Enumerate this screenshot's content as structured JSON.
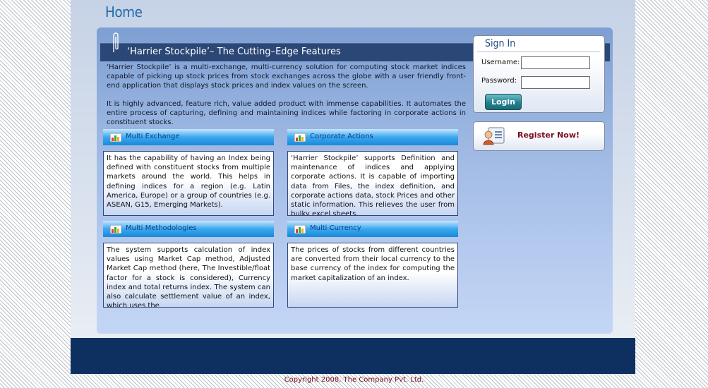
{
  "header": {
    "title": "Home"
  },
  "feature": {
    "title": "‘Harrier Stockpile’– The Cutting–Edge Features",
    "intro": [
      "‘Harrier Stockpile’ is a multi-exchange, multi-currency solution for computing stock market indices capable of picking up stock prices from stock exchanges across the globe with a user friendly front-end application that displays stock prices and index values on the screen.",
      "It is highly advanced, feature rich, value added product with immense capabilities. It automates the entire process of capturing, defining and maintaining indices while factoring in corporate actions in constituent stocks."
    ]
  },
  "boxes": [
    {
      "label": "Multi Exchange",
      "text": "It has the capability of having an Index being defined with constituent stocks from multiple markets around the world. This helps in defining indices for a region (e.g. Latin America, Europe) or a group of countries (e.g. ASEAN, G15, Emerging Markets)."
    },
    {
      "label": "Corporate Actions",
      "text": "‘Harrier Stockpile’ supports Definition and maintenance of indices and applying corporate actions. It is capable of importing data from Files, the index definition, and corporate actions data, stock Prices and other static information. This relieves the user from bulky excel sheets,"
    },
    {
      "label": "Multi Methodologies",
      "text": "The system supports calculation of index values using Market Cap method, Adjusted Market Cap method (here, The Investible/float factor for a stock is considered), Currency index and total returns index. The system can also calculate settlement value of an index, which uses the"
    },
    {
      "label": "Multi Currency",
      "text": "The prices of stocks from different countries are converted from their local currency to the base currency of the index for computing the market capitalization of an index."
    }
  ],
  "signin": {
    "title": "Sign In",
    "username_label": "Username:",
    "password_label": "Password:",
    "username_value": "",
    "password_value": "",
    "login_label": "Login"
  },
  "register": {
    "label": "Register Now!"
  },
  "footer": {
    "copyright": "Copyright 2008, The Company Pvt. Ltd."
  },
  "colors": {
    "accent": "#1e6aa8",
    "navy": "#0d3061",
    "brand_red": "#7a0d1d",
    "box_blue": "#1b88d8"
  }
}
